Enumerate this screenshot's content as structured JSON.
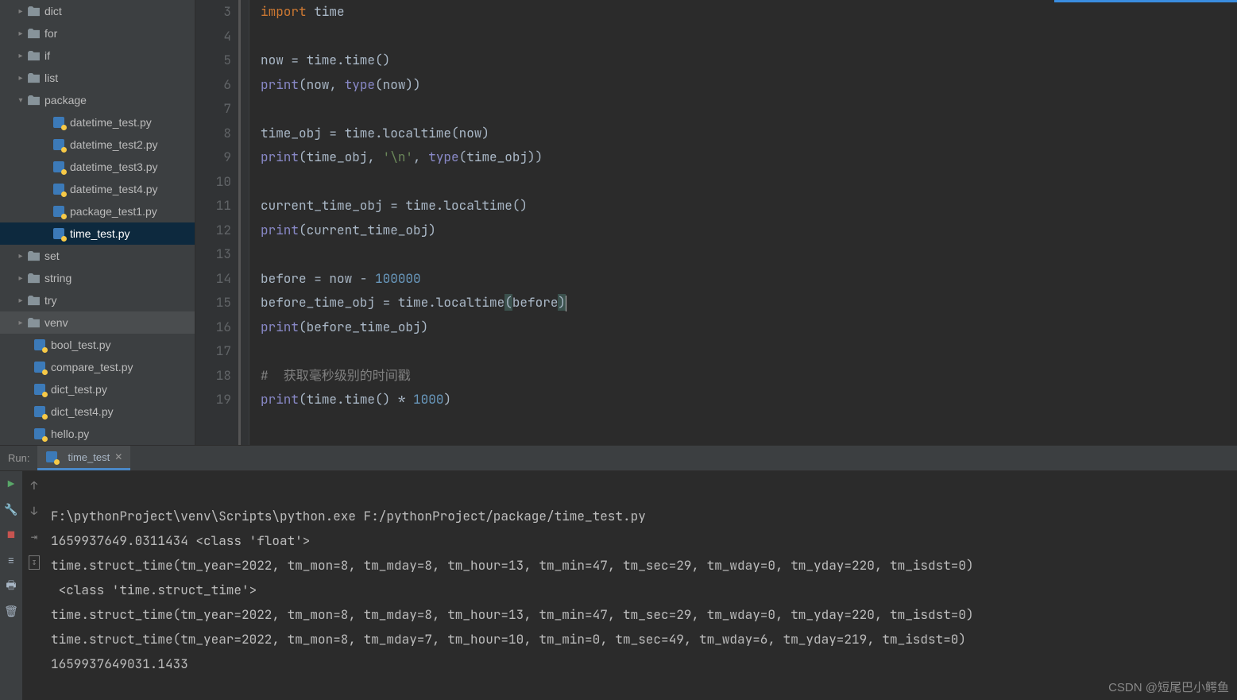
{
  "tree": {
    "dict": "dict",
    "for": "for",
    "if": "if",
    "list": "list",
    "package": "package",
    "package_files": [
      "datetime_test.py",
      "datetime_test2.py",
      "datetime_test3.py",
      "datetime_test4.py",
      "package_test1.py",
      "time_test.py"
    ],
    "set": "set",
    "string": "string",
    "try": "try",
    "venv": "venv",
    "root_files": [
      "bool_test.py",
      "compare_test.py",
      "dict_test.py",
      "dict_test4.py",
      "hello.py"
    ]
  },
  "code": {
    "l3": "import time",
    "l4": "",
    "l5": "now = time.time()",
    "l6": "print(now, type(now))",
    "l7": "",
    "l8": "time_obj = time.localtime(now)",
    "l9": "print(time_obj, '\\n', type(time_obj))",
    "l10": "",
    "l11": "current_time_obj = time.localtime()",
    "l12": "print(current_time_obj)",
    "l13": "",
    "l14": "before = now - 100000",
    "l15": "before_time_obj = time.localtime(before)",
    "l16": "print(before_time_obj)",
    "l17": "",
    "l18": "#  获取毫秒级别的时间戳",
    "l19": "print(time.time() * 1000)"
  },
  "gutter": [
    "3",
    "4",
    "5",
    "6",
    "7",
    "8",
    "9",
    "10",
    "11",
    "12",
    "13",
    "14",
    "15",
    "16",
    "17",
    "18",
    "19"
  ],
  "run": {
    "label": "Run:",
    "tab": "time_test",
    "out1": "F:\\pythonProject\\venv\\Scripts\\python.exe F:/pythonProject/package/time_test.py",
    "out2": "1659937649.0311434 <class 'float'>",
    "out3": "time.struct_time(tm_year=2022, tm_mon=8, tm_mday=8, tm_hour=13, tm_min=47, tm_sec=29, tm_wday=0, tm_yday=220, tm_isdst=0)",
    "out4": " <class 'time.struct_time'>",
    "out5": "time.struct_time(tm_year=2022, tm_mon=8, tm_mday=8, tm_hour=13, tm_min=47, tm_sec=29, tm_wday=0, tm_yday=220, tm_isdst=0)",
    "out6": "time.struct_time(tm_year=2022, tm_mon=8, tm_mday=7, tm_hour=10, tm_min=0, tm_sec=49, tm_wday=6, tm_yday=219, tm_isdst=0)",
    "out7": "1659937649031.1433"
  },
  "watermark": "CSDN @短尾巴小鳄鱼"
}
